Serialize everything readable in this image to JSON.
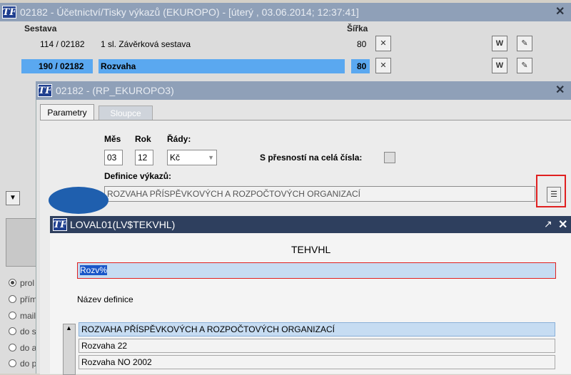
{
  "main_window": {
    "title": "02182 - Účetnictví/Tisky výkazů (EKUROPO) - [úterý  , 03.06.2014; 12:37:41]",
    "col_sestava": "Sestava",
    "col_sirka": "Šířka",
    "rows": [
      {
        "code": "114 / 02182",
        "name": "1 sl. Závěrková sestava",
        "width": "80"
      },
      {
        "code": "190 / 02182",
        "name": "Rozvaha",
        "width": "80"
      }
    ],
    "left_radios": [
      "prol",
      "přím",
      "mail",
      "do s",
      "do a",
      "do přílo"
    ]
  },
  "param_window": {
    "title": "02182 - (RP_EKUROPO3)",
    "tabs": [
      "Parametry",
      "Sloupce"
    ],
    "mes_label": "Měs",
    "rok_label": "Rok",
    "rady_label": "Řády:",
    "mes_value": "03",
    "rok_value": "12",
    "rady_value": "Kč",
    "presnost_label": "S přesností na celá čísla:",
    "definice_label": "Definice výkazů:",
    "definice_value": "ROZVAHA PŘÍSPĚVKOVÝCH A ROZPOČTOVÝCH ORGANIZACÍ"
  },
  "lov_window": {
    "title": "LOVAL01(LV$TEKVHL)",
    "heading": "TEHVHL",
    "search_value": "Rozv%",
    "list_label": "Název definice",
    "items": [
      "ROZVAHA PŘÍSPĚVKOVÝCH A ROZPOČTOVÝCH ORGANIZACÍ",
      "Rozvaha 22",
      "Rozvaha NO 2002"
    ]
  },
  "icons": {
    "logo": "tf-logo",
    "close": "close-icon",
    "maximize": "maximize-icon",
    "word": "word-icon",
    "edit": "edit-icon",
    "excel": "excel-icon",
    "list": "list-icon"
  }
}
